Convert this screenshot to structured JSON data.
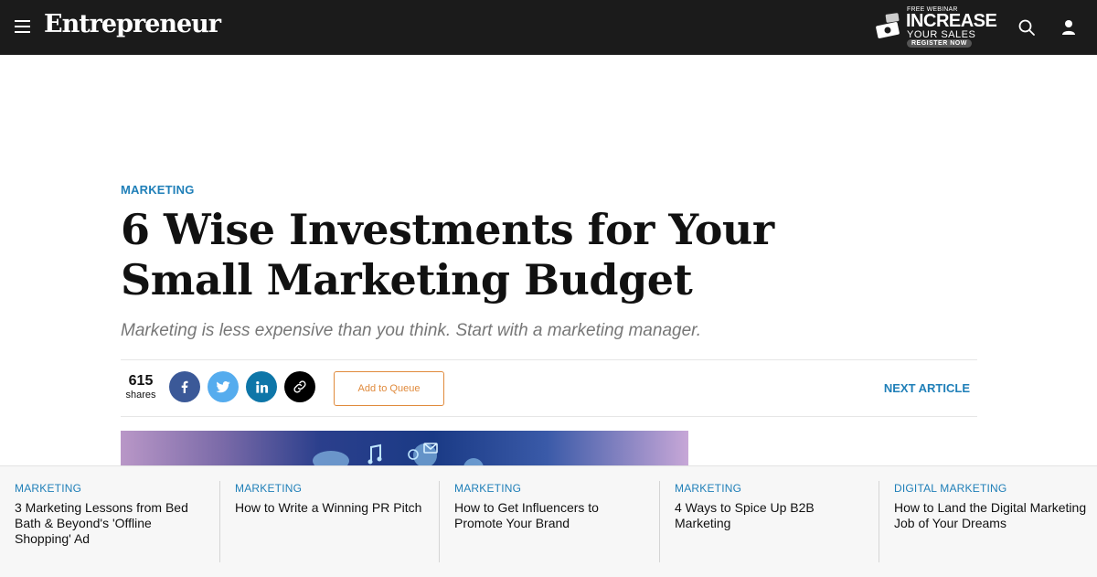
{
  "header": {
    "logo": "Entrepreneur",
    "promo": {
      "kicker": "FREE WEBINAR",
      "headline": "INCREASE",
      "subline": "YOUR SALES",
      "cta": "REGISTER NOW"
    }
  },
  "article": {
    "category": "MARKETING",
    "title": "6 Wise Investments for Your Small Marketing Budget",
    "subtitle": "Marketing is less expensive than you think. Start with a marketing manager.",
    "share_count": "615",
    "share_label": "shares",
    "queue_label": "Add to Queue",
    "next_label": "NEXT ARTICLE"
  },
  "related": [
    {
      "category": "MARKETING",
      "title": "3 Marketing Lessons from Bed Bath & Beyond's 'Offline Shopping' Ad"
    },
    {
      "category": "MARKETING",
      "title": "How to Write a Winning PR Pitch"
    },
    {
      "category": "MARKETING",
      "title": "How to Get Influencers to Promote Your Brand"
    },
    {
      "category": "MARKETING",
      "title": "4 Ways to Spice Up B2B Marketing"
    },
    {
      "category": "DIGITAL MARKETING",
      "title": "How to Land the Digital Marketing Job of Your Dreams"
    }
  ],
  "icons": {
    "menu": "menu-icon",
    "search": "search-icon",
    "user": "user-icon",
    "facebook": "facebook-icon",
    "twitter": "twitter-icon",
    "linkedin": "linkedin-icon",
    "link": "link-icon"
  },
  "colors": {
    "topbar": "#1b1b1b",
    "accent_blue": "#1f7fb8",
    "queue_orange": "#e08a3c",
    "facebook": "#3b5998",
    "twitter": "#55acee",
    "linkedin": "#0e76a8"
  }
}
